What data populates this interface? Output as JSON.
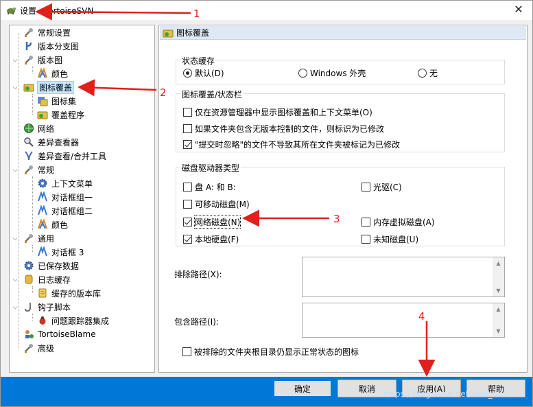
{
  "window": {
    "title": "设置 - TortoiseSVN",
    "close_glyph": "✕"
  },
  "tree": {
    "items": [
      {
        "label": "常规设置",
        "icon": "wrench-icon"
      },
      {
        "label": "版本分支图",
        "icon": "branch-icon"
      },
      {
        "label": "版本图",
        "icon": "wrench-icon"
      },
      {
        "label": "颜色",
        "icon": "palette-icon"
      },
      {
        "label": "图标覆盖",
        "icon": "overlay-icon"
      },
      {
        "label": "图标集",
        "icon": "iconset-icon"
      },
      {
        "label": "覆盖程序",
        "icon": "overlay-icon"
      },
      {
        "label": "网络",
        "icon": "globe-icon"
      },
      {
        "label": "差异查看器",
        "icon": "magnifier-icon"
      },
      {
        "label": "差异查看/合并工具",
        "icon": "merge-icon"
      },
      {
        "label": "常规",
        "icon": "wrench-icon"
      },
      {
        "label": "上下文菜单",
        "icon": "gear-icon"
      },
      {
        "label": "对话框组一",
        "icon": "dialog-icon"
      },
      {
        "label": "对话框组二",
        "icon": "dialog-icon"
      },
      {
        "label": "颜色",
        "icon": "palette-icon"
      },
      {
        "label": "通用",
        "icon": "wrench-icon"
      },
      {
        "label": "对话框 3",
        "icon": "dialog-icon"
      },
      {
        "label": "已保存数据",
        "icon": "gear-icon"
      },
      {
        "label": "日志缓存",
        "icon": "database-icon"
      },
      {
        "label": "缓存的版本库",
        "icon": "cache-icon"
      },
      {
        "label": "钩子脚本",
        "icon": "hook-icon"
      },
      {
        "label": "问题跟踪器集成",
        "icon": "bug-icon"
      },
      {
        "label": "TortoiseBlame",
        "icon": "blame-icon"
      },
      {
        "label": "高级",
        "icon": "wrench-icon"
      }
    ]
  },
  "panel": {
    "header_title": "图标覆盖",
    "status_cache": {
      "title": "状态缓存",
      "default_label": "默认(D)",
      "windows_shell_label": "Windows 外壳",
      "none_label": "无",
      "selected": "default"
    },
    "overlay_status": {
      "title": "图标覆盖/状态栏",
      "opt1": "仅在资源管理器中显示图标覆盖和上下文菜单(O)",
      "opt2": "如果文件夹包含无版本控制的文件，则标识为已修改",
      "opt3": "\"提交时忽略\"的文件不导致其所在文件夹被标记为已修改",
      "opt1_checked": false,
      "opt2_checked": false,
      "opt3_checked": true
    },
    "drive_types": {
      "title": "磁盘驱动器类型",
      "floppy": "盘 A: 和 B:",
      "removable": "可移动磁盘(M)",
      "network": "网络磁盘(N)",
      "local": "本地硬盘(F)",
      "cdrom": "光驱(C)",
      "ramdisk": "内存虚拟磁盘(A)",
      "unknown": "未知磁盘(U)",
      "floppy_checked": false,
      "removable_checked": false,
      "network_checked": true,
      "local_checked": true,
      "cdrom_checked": false,
      "ramdisk_checked": false,
      "unknown_checked": false
    },
    "exclude_label": "排除路径(X):",
    "include_label": "包含路径(I):",
    "exclude_value": "",
    "include_value": "",
    "show_excluded_label": "被排除的文件夹根目录仍显示正常状态的图标",
    "show_excluded_checked": false
  },
  "buttons": {
    "ok": "确定",
    "cancel": "取消",
    "apply": "应用(A)",
    "help": "帮助"
  },
  "watermark": "https://blog.csdn.net/wkd_007",
  "annotations": {
    "n1": "1",
    "n2": "2",
    "n3": "3",
    "n4": "4",
    "arrow_color": "#e0201c"
  },
  "colors": {
    "accent": "#0078d7",
    "selection": "#cce8ff",
    "header_bg": "#dfe8f5"
  }
}
